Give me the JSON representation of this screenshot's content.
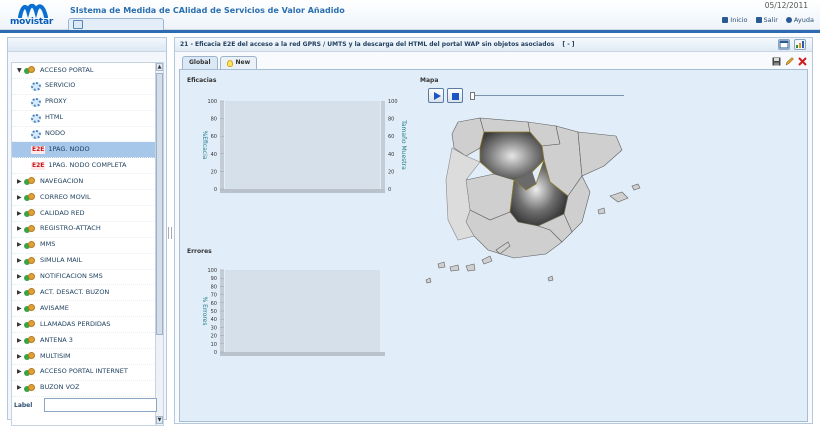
{
  "header": {
    "logo_text": "movistar",
    "app_title": "SIstema de Medida de CAlidad de Servicios de Valor Añadido",
    "date": "05/12/2011",
    "nav": [
      {
        "label": "Inicio",
        "icon": "home-icon"
      },
      {
        "label": "Salir",
        "icon": "exit-icon"
      },
      {
        "label": "Ayuda",
        "icon": "help-icon"
      }
    ]
  },
  "sidebar": {
    "items": [
      {
        "label": "ACCESO PORTAL",
        "type": "folder",
        "expanded": true
      },
      {
        "label": "SERVICIO",
        "type": "gear"
      },
      {
        "label": "PROXY",
        "type": "gear"
      },
      {
        "label": "HTML",
        "type": "gear"
      },
      {
        "label": "NODO",
        "type": "gear"
      },
      {
        "label": "1PAG. NODO",
        "type": "e2e",
        "selected": true
      },
      {
        "label": "1PAG. NODO COMPLETA",
        "type": "e2e"
      },
      {
        "label": "NAVEGACION",
        "type": "folder"
      },
      {
        "label": "CORREO MOVIL",
        "type": "folder"
      },
      {
        "label": "CALIDAD RED",
        "type": "folder"
      },
      {
        "label": "REGISTRO-ATTACH",
        "type": "folder"
      },
      {
        "label": "MMS",
        "type": "folder"
      },
      {
        "label": "SIMULA MAIL",
        "type": "folder"
      },
      {
        "label": "NOTIFICACION SMS",
        "type": "folder"
      },
      {
        "label": "ACT. DESACT. BUZON",
        "type": "folder"
      },
      {
        "label": "AVISAME",
        "type": "folder"
      },
      {
        "label": "LLAMADAS PERDIDAS",
        "type": "folder"
      },
      {
        "label": "ANTENA 3",
        "type": "folder"
      },
      {
        "label": "MULTISIM",
        "type": "folder"
      },
      {
        "label": "ACCESO PORTAL INTERNET",
        "type": "folder"
      },
      {
        "label": "BUZON VOZ",
        "type": "folder"
      }
    ],
    "e2e_tag": "E2E",
    "label_field": {
      "label": "Label",
      "value": ""
    }
  },
  "main": {
    "indicator_title": "21 - Eficacia E2E del acceso a la red GPRS / UMTS y la descarga del HTML del portal WAP sin objetos asociados",
    "title_suffix": "[ - ]",
    "tabs": [
      {
        "label": "Global",
        "active": true
      },
      {
        "label": "New",
        "active": false
      }
    ],
    "sections": {
      "eficacias": "Eficacias",
      "errores": "Errores",
      "mapa": "Mapa"
    }
  },
  "chart_data": [
    {
      "type": "bar",
      "title": "Eficacias",
      "ylabel": "%Eficacia",
      "y2label": "Tamaño Muestra",
      "ylim": [
        0,
        100
      ],
      "y_ticks": [
        "0",
        "20",
        "40",
        "60",
        "80",
        "100"
      ],
      "y2_ticks": [
        "0",
        "20",
        "40",
        "60",
        "80",
        "100"
      ],
      "categories": [],
      "values": []
    },
    {
      "type": "bar",
      "title": "Errores",
      "ylabel": "% Errores",
      "ylim": [
        0,
        100
      ],
      "y_ticks": [
        "0",
        "10",
        "20",
        "30",
        "40",
        "50",
        "60",
        "70",
        "80",
        "90",
        "100"
      ],
      "categories": [],
      "values": []
    }
  ],
  "colors": {
    "brand_blue": "#2e6bb0",
    "selected_row": "#a6c6ea",
    "content_bg": "#e1edf9",
    "map_gray": "#cfcfcf",
    "map_highlight": "#5a5a5a"
  }
}
